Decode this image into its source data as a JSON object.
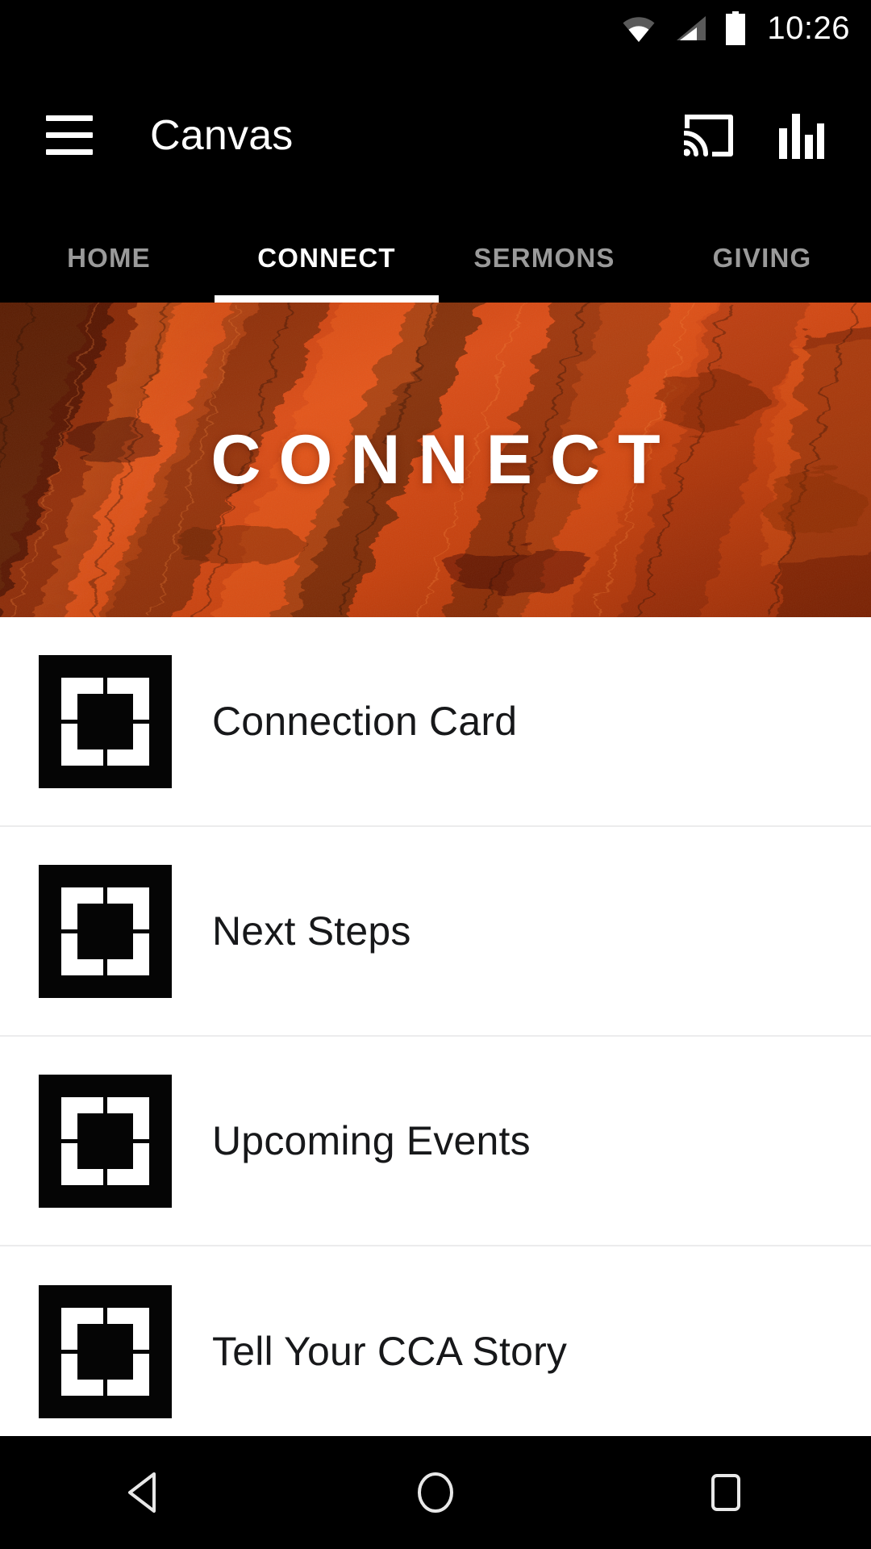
{
  "status_bar": {
    "time": "10:26",
    "icons": [
      "wifi-icon",
      "cellular-signal-icon",
      "battery-full-icon"
    ]
  },
  "app_bar": {
    "menu_icon": "hamburger-menu-icon",
    "title": "Canvas",
    "actions": [
      {
        "icon": "chromecast-icon",
        "label": "Cast"
      },
      {
        "icon": "bar-chart-icon",
        "label": "Stats"
      }
    ]
  },
  "tabs": {
    "items": [
      {
        "label": "HOME",
        "active": false
      },
      {
        "label": "CONNECT",
        "active": true
      },
      {
        "label": "SERMONS",
        "active": false
      },
      {
        "label": "GIVING",
        "active": false
      }
    ],
    "active_index": 1,
    "active_color": "#ffffff",
    "inactive_color": "#9a9a9a",
    "indicator_color": "#ffffff"
  },
  "banner": {
    "title": "CONNECT",
    "image_description": "textured orange painted rock surface",
    "colors": {
      "base": "#D2440F",
      "highlight": "#F2661B",
      "shadow": "#2A0C03",
      "deep": "#7A2408"
    }
  },
  "list": {
    "items": [
      {
        "label": "Connection Card",
        "icon": "corner-brackets-icon"
      },
      {
        "label": "Next Steps",
        "icon": "corner-brackets-icon"
      },
      {
        "label": "Upcoming Events",
        "icon": "corner-brackets-icon"
      },
      {
        "label": "Tell Your CCA Story",
        "icon": "corner-brackets-icon"
      }
    ],
    "divider_color": "#ececed",
    "background": "#ffffff",
    "text_color": "#17181a"
  },
  "nav_bar": {
    "buttons": [
      {
        "name": "back-button",
        "icon": "triangle-back-icon"
      },
      {
        "name": "home-button",
        "icon": "circle-home-icon"
      },
      {
        "name": "recents-button",
        "icon": "square-recents-icon"
      }
    ],
    "background": "#000000"
  }
}
